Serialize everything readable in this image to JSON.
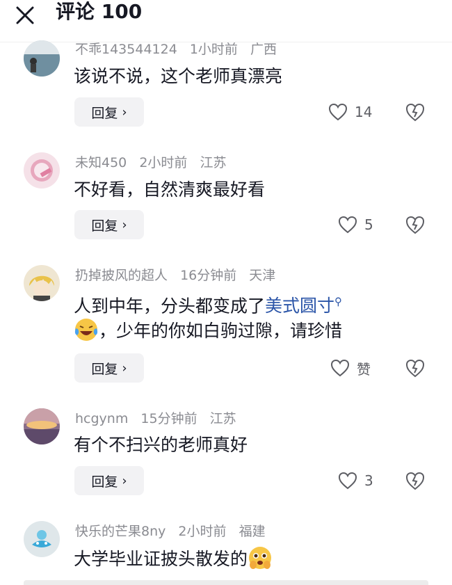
{
  "header": {
    "title": "评论 100"
  },
  "reply_label": "回复",
  "comments": [
    {
      "user": "不乖143544124",
      "time": "1小时前",
      "location": "广西",
      "text": "该说不说，这个老师真漂亮",
      "likes": "14"
    },
    {
      "user": "未知450",
      "time": "2小时前",
      "location": "江苏",
      "text": "不好看，自然清爽最好看",
      "likes": "5"
    },
    {
      "user": "扔掉披风的超人",
      "time": "16分钟前",
      "location": "天津",
      "text_line1": "人到中年，分头都变成了",
      "hashtag": "美式圆寸",
      "text_line2": "，少年的你如白驹过隙，请珍惜",
      "likes": "赞"
    },
    {
      "user": "hcgynm",
      "time": "15分钟前",
      "location": "江苏",
      "text": "有个不扫兴的老师真好",
      "likes": "3"
    },
    {
      "user": "快乐的芒果8ny",
      "time": "2小时前",
      "location": "福建",
      "text": "大学毕业证披头散发的"
    }
  ],
  "colors": {
    "text": "#161823",
    "meta": "#8a8b91",
    "link": "#2b55a8",
    "reply_bg": "#f2f2f4"
  },
  "icons": [
    "close-icon",
    "heart-icon",
    "broken-heart-icon",
    "search-icon",
    "laughing-crying-emoji",
    "pleading-emoji"
  ]
}
